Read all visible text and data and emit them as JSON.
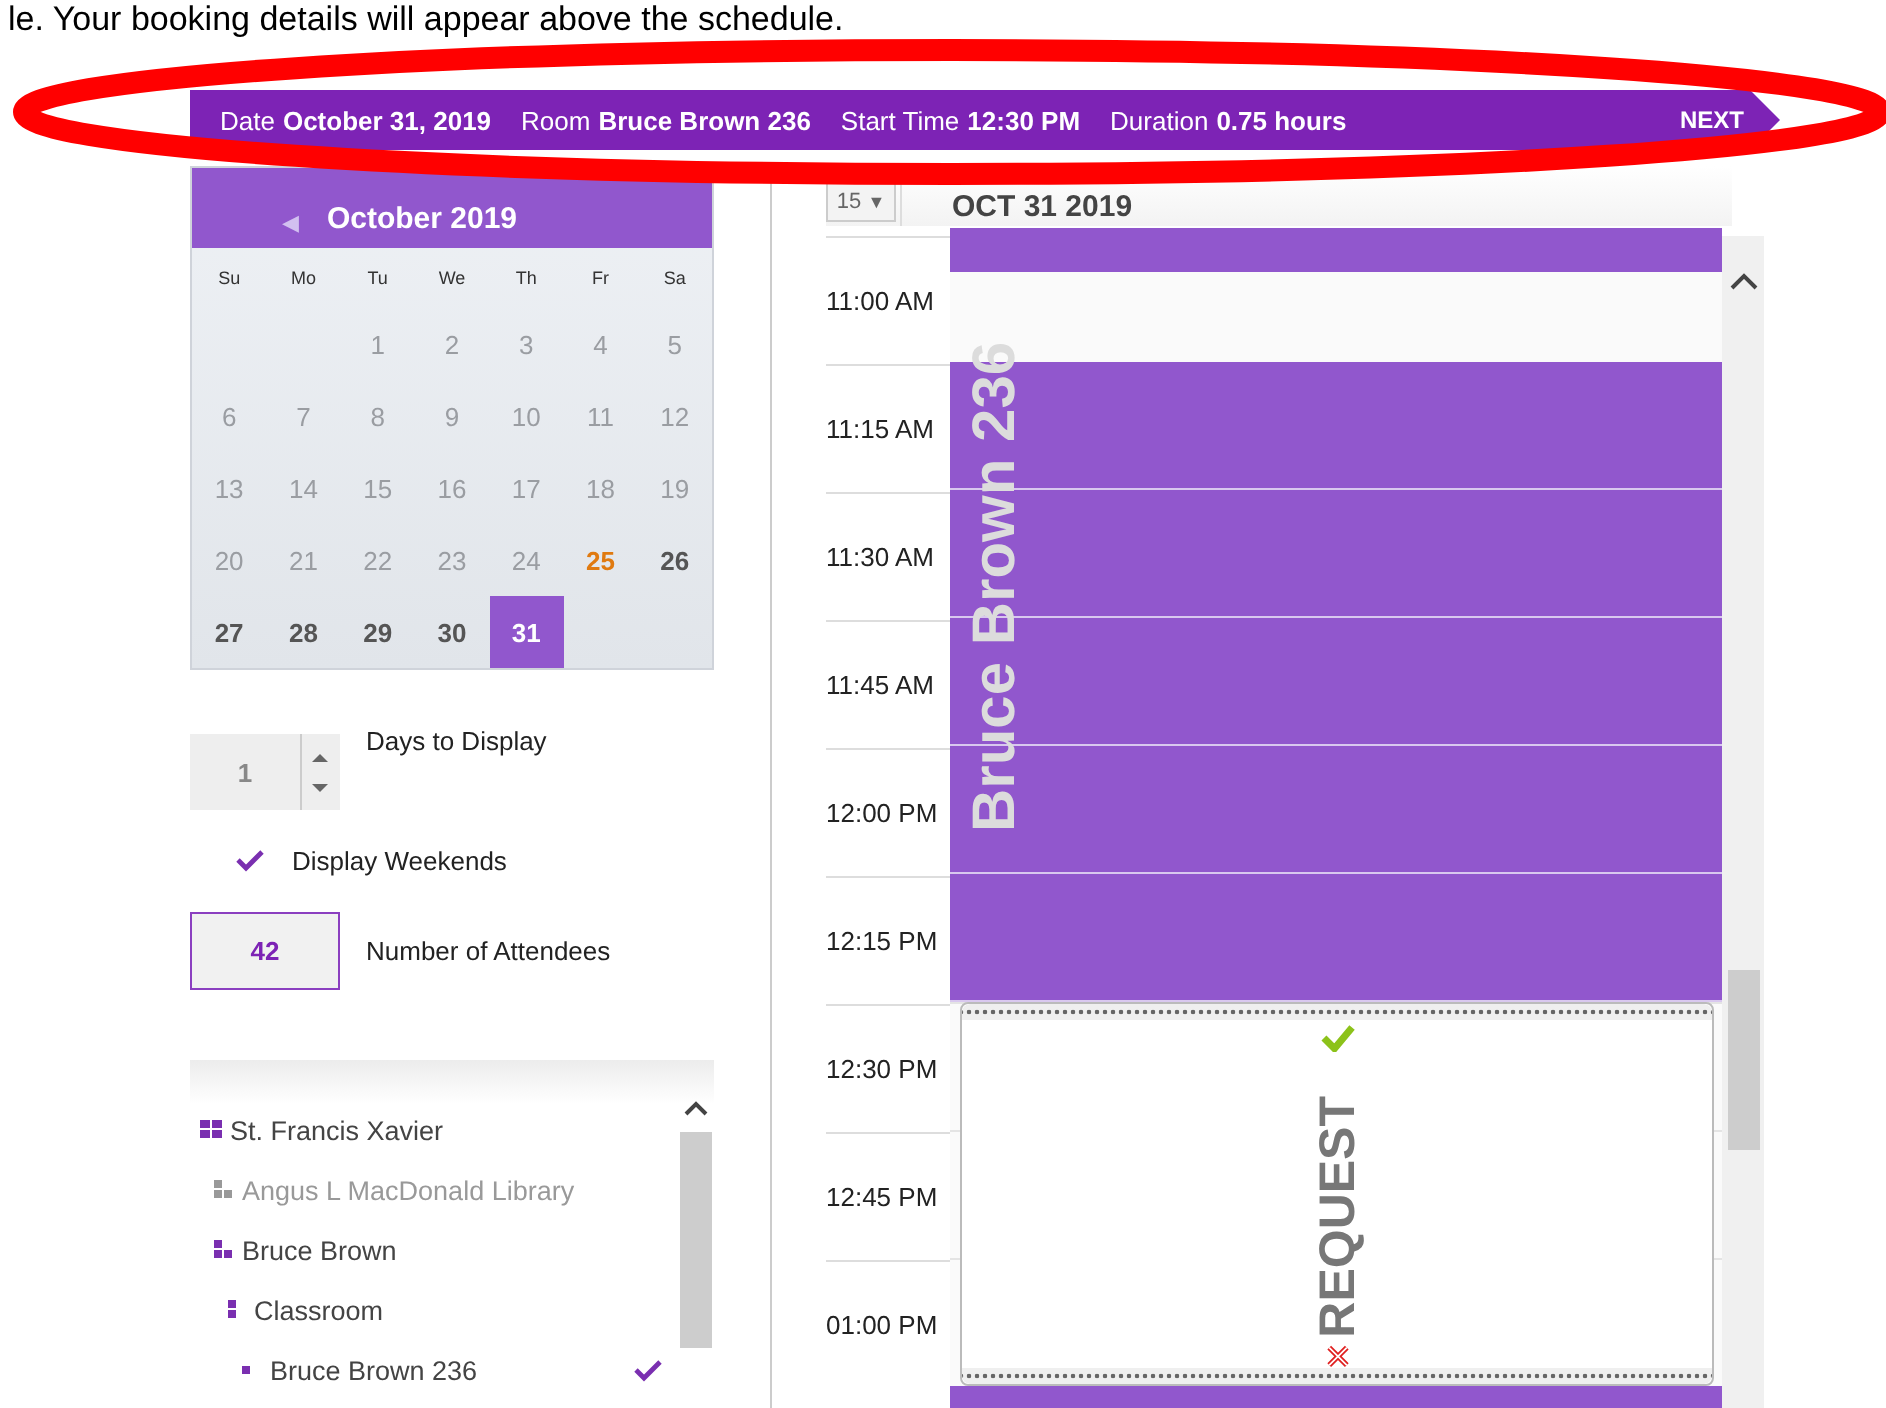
{
  "instruction": "le. Your booking details will appear above the schedule.",
  "booking_bar": {
    "fields": [
      {
        "label": "Date",
        "value": "October 31, 2019"
      },
      {
        "label": "Room",
        "value": "Bruce Brown 236"
      },
      {
        "label": "Start Time",
        "value": "12:30 PM"
      },
      {
        "label": "Duration",
        "value": "0.75 hours"
      }
    ],
    "next": "NEXT"
  },
  "calendar": {
    "month": "October 2019",
    "prev": "◀",
    "weekdays": [
      "Su",
      "Mo",
      "Tu",
      "We",
      "Th",
      "Fr",
      "Sa"
    ],
    "weeks": [
      [
        {
          "day": "1",
          "disabled": true,
          "today": false,
          "selected": false
        },
        {
          "day": "2",
          "disabled": true,
          "today": false,
          "selected": false
        },
        {
          "day": "3",
          "disabled": true,
          "today": false,
          "selected": false
        },
        {
          "day": "4",
          "disabled": true,
          "today": false,
          "selected": false
        },
        {
          "day": "5",
          "disabled": true,
          "today": false,
          "selected": false
        }
      ],
      [
        {
          "day": "6",
          "disabled": true,
          "today": false,
          "selected": false
        },
        {
          "day": "7",
          "disabled": true,
          "today": false,
          "selected": false
        },
        {
          "day": "8",
          "disabled": true,
          "today": false,
          "selected": false
        },
        {
          "day": "9",
          "disabled": true,
          "today": false,
          "selected": false
        },
        {
          "day": "10",
          "disabled": true,
          "today": false,
          "selected": false
        },
        {
          "day": "11",
          "disabled": true,
          "today": false,
          "selected": false
        },
        {
          "day": "12",
          "disabled": true,
          "today": false,
          "selected": false
        }
      ],
      [
        {
          "day": "13",
          "disabled": true,
          "today": false,
          "selected": false
        },
        {
          "day": "14",
          "disabled": true,
          "today": false,
          "selected": false
        },
        {
          "day": "15",
          "disabled": true,
          "today": false,
          "selected": false
        },
        {
          "day": "16",
          "disabled": true,
          "today": false,
          "selected": false
        },
        {
          "day": "17",
          "disabled": true,
          "today": false,
          "selected": false
        },
        {
          "day": "18",
          "disabled": true,
          "today": false,
          "selected": false
        },
        {
          "day": "19",
          "disabled": true,
          "today": false,
          "selected": false
        }
      ],
      [
        {
          "day": "20",
          "disabled": true,
          "today": false,
          "selected": false
        },
        {
          "day": "21",
          "disabled": true,
          "today": false,
          "selected": false
        },
        {
          "day": "22",
          "disabled": true,
          "today": false,
          "selected": false
        },
        {
          "day": "23",
          "disabled": true,
          "today": false,
          "selected": false
        },
        {
          "day": "24",
          "disabled": true,
          "today": false,
          "selected": false
        },
        {
          "day": "25",
          "disabled": false,
          "today": true,
          "selected": false
        },
        {
          "day": "26",
          "disabled": false,
          "today": false,
          "selected": false
        }
      ],
      [
        {
          "day": "27",
          "disabled": false,
          "today": false,
          "selected": false
        },
        {
          "day": "28",
          "disabled": false,
          "today": false,
          "selected": false
        },
        {
          "day": "29",
          "disabled": false,
          "today": false,
          "selected": false
        },
        {
          "day": "30",
          "disabled": false,
          "today": false,
          "selected": false
        },
        {
          "day": "31",
          "disabled": false,
          "today": false,
          "selected": true
        }
      ]
    ]
  },
  "days_to_display": {
    "value": "1",
    "label": "Days to Display"
  },
  "display_weekends": {
    "checked": true,
    "label": "Display Weekends"
  },
  "attendees": {
    "value": "42",
    "label": "Number of Attendees"
  },
  "tree": [
    {
      "label": "St. Francis Xavier",
      "disabled": false,
      "checked": false,
      "children": [
        {
          "label": "Angus L MacDonald Library",
          "disabled": true,
          "checked": false
        },
        {
          "label": "Bruce Brown",
          "disabled": false,
          "checked": false,
          "children": [
            {
              "label": "Classroom",
              "disabled": false,
              "checked": false,
              "children": [
                {
                  "label": "Bruce Brown 236",
                  "disabled": false,
                  "checked": true
                }
              ]
            }
          ]
        }
      ]
    }
  ],
  "schedule": {
    "interval": "15",
    "interval_caret": "▼",
    "date": "OCT 31 2019",
    "times": [
      "11:00 AM",
      "11:15 AM",
      "11:30 AM",
      "11:45 AM",
      "12:00 PM",
      "12:15 PM",
      "12:30 PM",
      "12:45 PM",
      "01:00 PM"
    ],
    "events": [
      {
        "kind": "booked"
      },
      {
        "kind": "booked",
        "title": "Bruce Brown 236"
      },
      {
        "kind": "request",
        "title": "REQUEST"
      },
      {
        "kind": "booked"
      }
    ]
  }
}
